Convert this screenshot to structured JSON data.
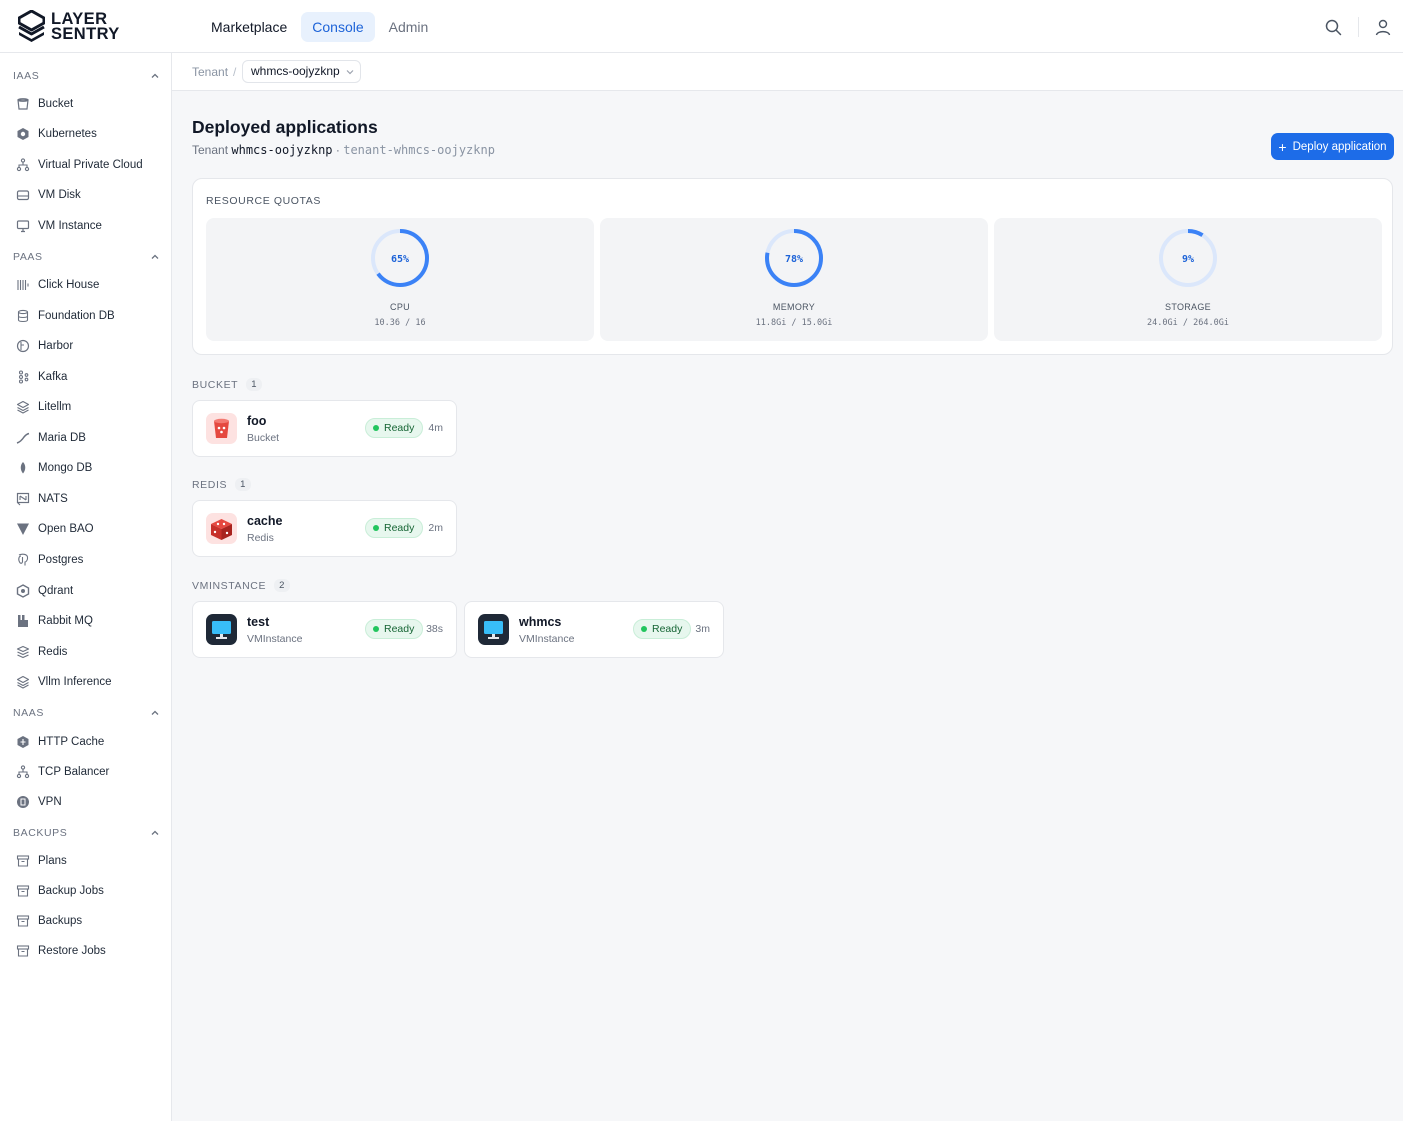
{
  "brand": {
    "line1": "LAYER",
    "line2": "SENTRY"
  },
  "topnav": {
    "tabs": [
      {
        "label": "Marketplace"
      },
      {
        "label": "Console"
      },
      {
        "label": "Admin"
      }
    ],
    "active": "Console"
  },
  "sidebar": {
    "sections": [
      {
        "title": "IAAS",
        "items": [
          {
            "label": "Bucket",
            "icon": "bucket-icon"
          },
          {
            "label": "Kubernetes",
            "icon": "kubernetes-icon"
          },
          {
            "label": "Virtual Private Cloud",
            "icon": "network-icon"
          },
          {
            "label": "VM Disk",
            "icon": "disk-icon"
          },
          {
            "label": "VM Instance",
            "icon": "monitor-icon"
          }
        ]
      },
      {
        "title": "PAAS",
        "items": [
          {
            "label": "Click House",
            "icon": "clickhouse-icon"
          },
          {
            "label": "Foundation DB",
            "icon": "database-icon"
          },
          {
            "label": "Harbor",
            "icon": "harbor-icon"
          },
          {
            "label": "Kafka",
            "icon": "kafka-icon"
          },
          {
            "label": "Litellm",
            "icon": "layers-icon"
          },
          {
            "label": "Maria DB",
            "icon": "mariadb-icon"
          },
          {
            "label": "Mongo DB",
            "icon": "mongodb-icon"
          },
          {
            "label": "NATS",
            "icon": "nats-icon"
          },
          {
            "label": "Open BAO",
            "icon": "openbao-icon"
          },
          {
            "label": "Postgres",
            "icon": "postgres-icon"
          },
          {
            "label": "Qdrant",
            "icon": "qdrant-icon"
          },
          {
            "label": "Rabbit MQ",
            "icon": "rabbitmq-icon"
          },
          {
            "label": "Redis",
            "icon": "redis-icon"
          },
          {
            "label": "Vllm Inference",
            "icon": "layers-icon"
          }
        ]
      },
      {
        "title": "NAAS",
        "items": [
          {
            "label": "HTTP Cache",
            "icon": "http-cache-icon"
          },
          {
            "label": "TCP Balancer",
            "icon": "network-icon"
          },
          {
            "label": "VPN",
            "icon": "vpn-icon"
          }
        ]
      },
      {
        "title": "BACKUPS",
        "items": [
          {
            "label": "Plans",
            "icon": "archive-icon"
          },
          {
            "label": "Backup Jobs",
            "icon": "archive-icon"
          },
          {
            "label": "Backups",
            "icon": "archive-icon"
          },
          {
            "label": "Restore Jobs",
            "icon": "archive-icon"
          }
        ]
      }
    ]
  },
  "breadcrumb": {
    "root": "Tenant",
    "separator": "/",
    "current": "whmcs-oojyzknp"
  },
  "page": {
    "title": "Deployed applications",
    "subtitle_prefix": "Tenant",
    "tenant_name": "whmcs-oojyzknp",
    "dot": "·",
    "namespace": "tenant-whmcs-oojyzknp",
    "deploy_button": "Deploy application"
  },
  "quotas": {
    "title": "RESOURCE QUOTAS",
    "items": [
      {
        "label": "CPU",
        "percent": 65,
        "percent_text": "65%",
        "usage": "10.36 / 16"
      },
      {
        "label": "MEMORY",
        "percent": 78,
        "percent_text": "78%",
        "usage": "11.8Gi / 15.0Gi"
      },
      {
        "label": "STORAGE",
        "percent": 9,
        "percent_text": "9%",
        "usage": "24.0Gi / 264.0Gi"
      }
    ]
  },
  "groups": [
    {
      "title": "BUCKET",
      "count": "1",
      "apps": [
        {
          "name": "foo",
          "type": "Bucket",
          "status": "Ready",
          "age": "4m",
          "icon": "bucket-app-icon"
        }
      ]
    },
    {
      "title": "REDIS",
      "count": "1",
      "apps": [
        {
          "name": "cache",
          "type": "Redis",
          "status": "Ready",
          "age": "2m",
          "icon": "redis-app-icon"
        }
      ]
    },
    {
      "title": "VMINSTANCE",
      "count": "2",
      "apps": [
        {
          "name": "test",
          "type": "VMInstance",
          "status": "Ready",
          "age": "38s",
          "icon": "vm-app-icon"
        },
        {
          "name": "whmcs",
          "type": "VMInstance",
          "status": "Ready",
          "age": "3m",
          "icon": "vm-app-icon"
        }
      ]
    }
  ],
  "colors": {
    "accent": "#1d6ce8",
    "ring": "#3b82f6",
    "ring_track": "#dbe7fb",
    "ready_bg": "#e7f7ee",
    "ready_dot": "#22c55e"
  }
}
